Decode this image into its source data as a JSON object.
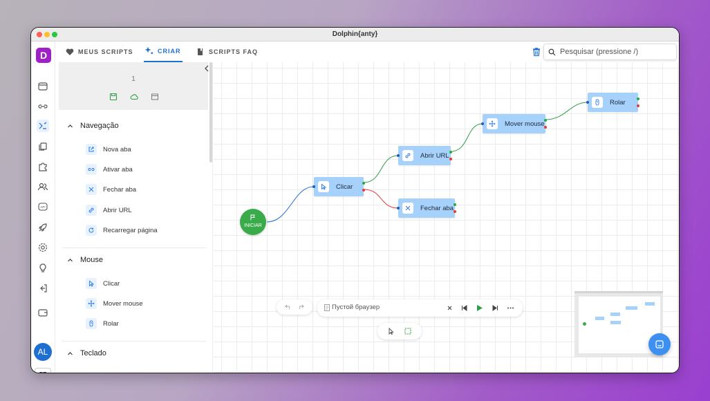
{
  "window": {
    "title": "Dolphin{anty}"
  },
  "app": {
    "logo_letter": "D",
    "accent": "#1e6fd0",
    "brand": "#a020c8"
  },
  "rail": {
    "icons": [
      "browser-icon",
      "link-icon",
      "automation-icon",
      "copy-icon",
      "puzzle-icon",
      "users-icon",
      "api-icon",
      "rocket-icon",
      "settings-icon",
      "bulb-icon",
      "logout-icon",
      "wallet-icon"
    ],
    "avatar_initials": "AL",
    "language": "PT"
  },
  "nav": {
    "tabs": [
      {
        "label": "MEUS SCRIPTS",
        "icon": "heart-icon"
      },
      {
        "label": "CRIAR",
        "icon": "sparkle-icon",
        "active": true
      },
      {
        "label": "SCRIPTS FAQ",
        "icon": "book-icon"
      }
    ],
    "search_placeholder": "Pesquisar (pressione /)"
  },
  "panel": {
    "script_number": "1",
    "sections": [
      {
        "title": "Navegação",
        "items": [
          {
            "label": "Nova aba",
            "icon": "new-tab-icon"
          },
          {
            "label": "Ativar aba",
            "icon": "link-icon"
          },
          {
            "label": "Fechar aba",
            "icon": "close-icon"
          },
          {
            "label": "Abrir URL",
            "icon": "chain-icon"
          },
          {
            "label": "Recarregar página",
            "icon": "reload-icon"
          }
        ]
      },
      {
        "title": "Mouse",
        "items": [
          {
            "label": "Clicar",
            "icon": "cursor-icon"
          },
          {
            "label": "Mover mouse",
            "icon": "move-icon"
          },
          {
            "label": "Rolar",
            "icon": "mouse-scroll-icon"
          }
        ]
      },
      {
        "title": "Teclado",
        "items": []
      }
    ]
  },
  "flow": {
    "start_label": "INICIAR",
    "nodes": [
      {
        "label": "Clicar",
        "icon": "cursor-icon"
      },
      {
        "label": "Abrir URL",
        "icon": "chain-icon"
      },
      {
        "label": "Fechar aba",
        "icon": "close-icon"
      },
      {
        "label": "Mover mouse",
        "icon": "move-icon"
      },
      {
        "label": "Rolar",
        "icon": "mouse-scroll-icon"
      }
    ]
  },
  "runner": {
    "profile_label": "Пустой браузер"
  }
}
